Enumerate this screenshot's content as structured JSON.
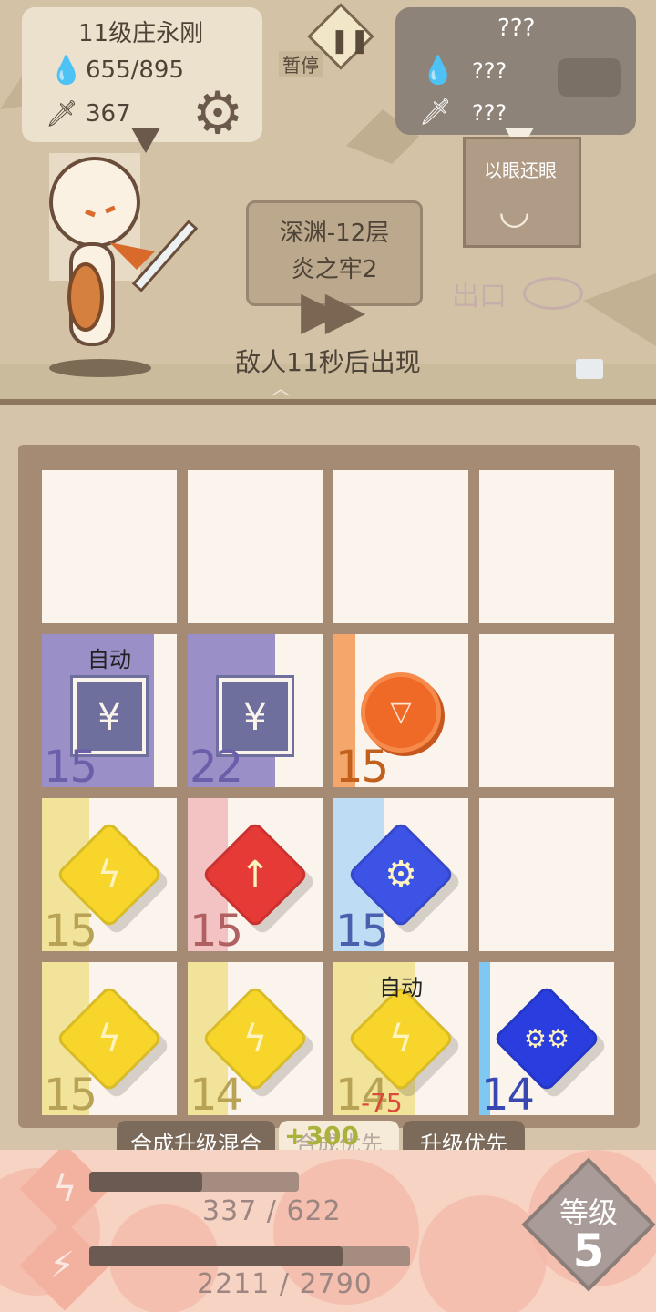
{
  "player": {
    "name": "11级庄永刚",
    "hp": "655/895",
    "attack": "367"
  },
  "pause": {
    "label": "暂停"
  },
  "enemy": {
    "name": "???",
    "hp": "???",
    "attack": "???"
  },
  "skill_card": {
    "label": "以眼还眼"
  },
  "exit": {
    "label": "出口"
  },
  "stage": {
    "line1": "深渊-12层",
    "line2": "炎之牢2"
  },
  "status_text": "敌人11秒后出现",
  "board": {
    "cells": [
      {
        "row": 0,
        "col": 0,
        "empty": true
      },
      {
        "row": 0,
        "col": 1,
        "empty": true
      },
      {
        "row": 0,
        "col": 2,
        "empty": true
      },
      {
        "row": 0,
        "col": 3,
        "empty": true
      },
      {
        "row": 1,
        "col": 0,
        "type": "yen-doc",
        "icon": "yen-document-icon",
        "level": "15",
        "auto": "自动",
        "strip_color": "#9b8fc8",
        "fill_fraction": 0.83,
        "level_color": "#6a5fa8"
      },
      {
        "row": 1,
        "col": 1,
        "type": "yen-doc",
        "icon": "yen-document-icon",
        "level": "22",
        "auto": "",
        "strip_color": "#9b8fc8",
        "fill_fraction": 0.65,
        "level_color": "#6a5fa8"
      },
      {
        "row": 1,
        "col": 2,
        "type": "coin",
        "icon": "coin-icon",
        "level": "15",
        "auto": "",
        "strip_color": "#f4a66b",
        "fill_fraction": 0.16,
        "level_color": "#c0601c"
      },
      {
        "row": 1,
        "col": 3,
        "empty": true
      },
      {
        "row": 2,
        "col": 0,
        "type": "gem",
        "icon": "lightning-icon",
        "glyph": "ϟ",
        "gem_color": "#f7d52b",
        "level": "15",
        "auto": "",
        "strip_color": "#f2e39a",
        "fill_fraction": 0.35,
        "level_color": "#b8a255"
      },
      {
        "row": 2,
        "col": 1,
        "type": "gem",
        "icon": "arrow-up-icon",
        "glyph": "↑",
        "gem_color": "#e53a35",
        "level": "15",
        "auto": "",
        "strip_color": "#f3c3c3",
        "fill_fraction": 0.3,
        "level_color": "#b06060"
      },
      {
        "row": 2,
        "col": 2,
        "type": "gem",
        "icon": "gear-icon",
        "glyph": "⚙",
        "gem_color": "#3d53e6",
        "level": "15",
        "auto": "",
        "strip_color": "#bfdcf5",
        "fill_fraction": 0.37,
        "level_color": "#4a5fae"
      },
      {
        "row": 2,
        "col": 3,
        "empty": true
      },
      {
        "row": 3,
        "col": 0,
        "type": "gem",
        "icon": "lightning-icon",
        "glyph": "ϟ",
        "gem_color": "#f7d52b",
        "level": "15",
        "auto": "",
        "strip_color": "#f2e39a",
        "fill_fraction": 0.35,
        "level_color": "#b8a255"
      },
      {
        "row": 3,
        "col": 1,
        "type": "gem",
        "icon": "lightning-icon",
        "glyph": "ϟ",
        "gem_color": "#f7d52b",
        "level": "14",
        "auto": "",
        "strip_color": "#f2e39a",
        "fill_fraction": 0.3,
        "level_color": "#b8a255"
      },
      {
        "row": 3,
        "col": 2,
        "type": "gem",
        "icon": "lightning-icon",
        "glyph": "ϟ",
        "gem_color": "#f7d52b",
        "level": "14",
        "auto": "自动",
        "strip_color": "#f2e39a",
        "fill_fraction": 0.6,
        "level_color": "#b8a255"
      },
      {
        "row": 3,
        "col": 3,
        "type": "gem",
        "icon": "double-gear-icon",
        "glyph": "⚙⚙",
        "gem_color": "#2a3ee0",
        "level": "14",
        "auto": "",
        "strip_color": "#7fc8f2",
        "fill_fraction": 0.08,
        "level_color": "#3848b0"
      }
    ],
    "float_gain": "+300",
    "float_loss": "-75"
  },
  "modes": {
    "merge_mix": "合成升级混合",
    "merge_first": "合成优先",
    "upgrade_first": "升级优先"
  },
  "progress": {
    "energy_text": "337 / 622",
    "energy_fraction": 0.54,
    "xp_text": "2211 / 2790",
    "xp_fraction": 0.79
  },
  "level_badge": {
    "label": "等级",
    "value": "5"
  },
  "colors": {
    "board_frame": "#a68b74",
    "cell_bg": "#fbf4ec",
    "hud_card": "#ece1cd",
    "pill": "#7c6a5a"
  }
}
